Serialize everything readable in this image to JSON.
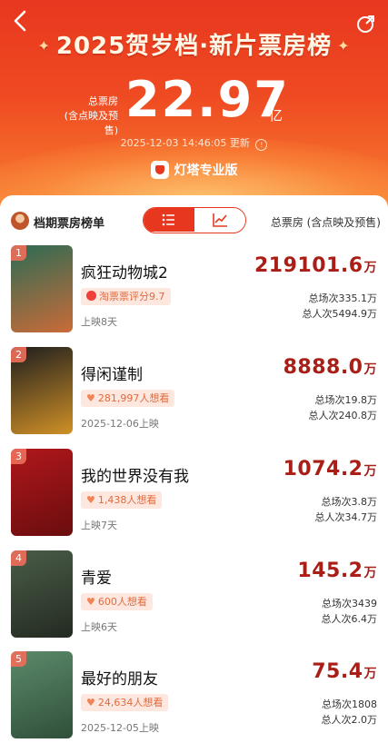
{
  "header": {
    "title_main": "2025贺岁档·新片票房榜",
    "total_label_line1": "总票房",
    "total_label_line2": "(含点映及预售)",
    "total_value": "22.97",
    "total_unit": "亿",
    "updated_time": "2025-12-03 14:46:05",
    "updated_suffix": "更新",
    "brand": "灯塔专业版"
  },
  "panel": {
    "title": "档期票房榜单",
    "column_header": "总票房 (含点映及预售)",
    "toggle_icons": [
      "list-icon",
      "trend-icon"
    ]
  },
  "movies": [
    {
      "rank": "1",
      "name": "疯狂动物城2",
      "tag": "淘票票评分9.7",
      "sub": "上映8天",
      "box": "219101.6",
      "box_unit": "万",
      "screenings": "总场次335.1万",
      "admissions": "总人次5494.9万",
      "poster_text": "",
      "poster_colors": [
        "#2c6b54",
        "#ca6b38"
      ]
    },
    {
      "rank": "2",
      "name": "得闲谨制",
      "tag": "281,997人想看",
      "sub": "2025-12-06上映",
      "box": "8888.0",
      "box_unit": "万",
      "screenings": "总场次19.8万",
      "admissions": "总人次240.8万",
      "poster_text": "",
      "poster_colors": [
        "#1e1e1e",
        "#d09026"
      ]
    },
    {
      "rank": "3",
      "name": "我的世界没有我",
      "tag": "1,438人想看",
      "sub": "上映7天",
      "box": "1074.2",
      "box_unit": "万",
      "screenings": "总场次3.8万",
      "admissions": "总人次34.7万",
      "poster_text": "",
      "poster_colors": [
        "#b0171a",
        "#6a0d0f"
      ]
    },
    {
      "rank": "4",
      "name": "青爱",
      "tag": "600人想看",
      "sub": "上映6天",
      "box": "145.2",
      "box_unit": "万",
      "screenings": "总场次3439",
      "admissions": "总人次6.4万",
      "poster_text": "",
      "poster_colors": [
        "#4a5d48",
        "#242a22"
      ]
    },
    {
      "rank": "5",
      "name": "最好的朋友",
      "tag": "24,634人想看",
      "sub": "2025-12-05上映",
      "box": "75.4",
      "box_unit": "万",
      "screenings": "总场次1808",
      "admissions": "总人次2.0万",
      "poster_text": "",
      "poster_colors": [
        "#5c8a6a",
        "#2f4f3a"
      ]
    }
  ],
  "colors": {
    "accent": "#e8371f",
    "box_red": "#a91e16",
    "tag_bg": "#fde7df"
  }
}
